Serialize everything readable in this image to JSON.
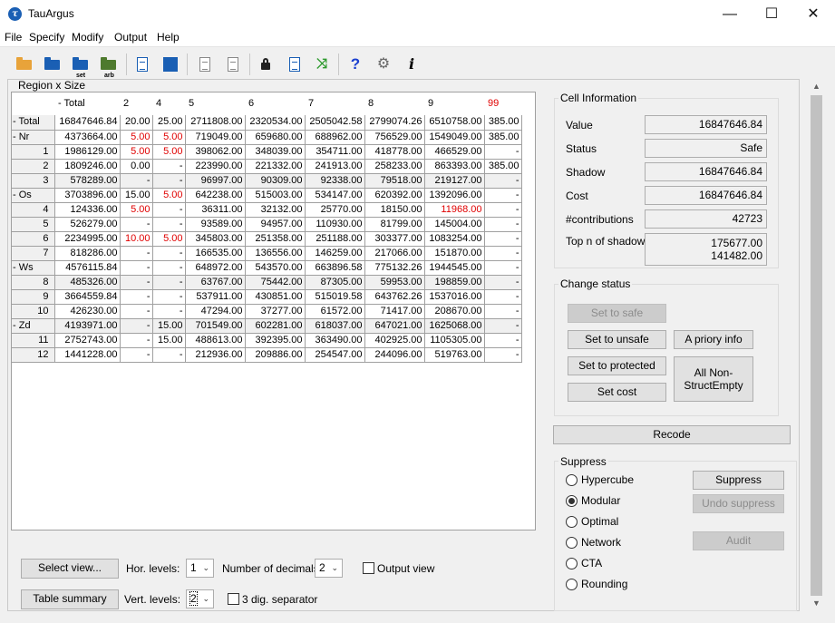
{
  "window": {
    "title": "TauArgus",
    "minimize": "—",
    "maximize": "☐",
    "close": "✕"
  },
  "menu": [
    "File",
    "Specify",
    "Modify",
    "Output",
    "Help"
  ],
  "toolbar": {
    "icons": [
      "open-table-icon",
      "open-batch-icon",
      "open-set-icon",
      "open-arb-icon",
      "view-report-icon",
      "table-list-icon",
      "output-icon",
      "output-save-icon",
      "lock-icon",
      "search-doc-icon",
      "shuffle-icon",
      "help-icon",
      "settings-icon",
      "info-icon"
    ],
    "sub_set": "set",
    "sub_arb": "arb",
    "help_glyph": "?",
    "info_glyph": "i",
    "shuffle_glyph": "⤨",
    "settings_glyph": "⚙"
  },
  "table": {
    "title": "Region x Size",
    "columns": [
      "- Total",
      "2",
      "4",
      "5",
      "6",
      "7",
      "8",
      "9",
      "99"
    ],
    "rows": [
      {
        "label": "- Total",
        "sub": false,
        "cells": [
          "16847646.84",
          "20.00",
          "25.00",
          "2711808.00",
          "2320534.00",
          "2505042.58",
          "2799074.26",
          "6510758.00",
          "385.00"
        ],
        "red": []
      },
      {
        "label": "- Nr",
        "sub": false,
        "cells": [
          "4373664.00",
          "5.00",
          "5.00",
          "719049.00",
          "659680.00",
          "688962.00",
          "756529.00",
          "1549049.00",
          "385.00"
        ],
        "red": [
          1,
          2
        ]
      },
      {
        "label": "1",
        "sub": true,
        "cells": [
          "1986129.00",
          "5.00",
          "5.00",
          "398062.00",
          "348039.00",
          "354711.00",
          "418778.00",
          "466529.00",
          "-"
        ],
        "red": [
          1,
          2
        ]
      },
      {
        "label": "2",
        "sub": true,
        "cells": [
          "1809246.00",
          "0.00",
          "-",
          "223990.00",
          "221332.00",
          "241913.00",
          "258233.00",
          "863393.00",
          "385.00"
        ],
        "red": []
      },
      {
        "label": "3",
        "sub": true,
        "cells": [
          "578289.00",
          "-",
          "-",
          "96997.00",
          "90309.00",
          "92338.00",
          "79518.00",
          "219127.00",
          "-"
        ],
        "red": []
      },
      {
        "label": "- Os",
        "sub": false,
        "cells": [
          "3703896.00",
          "15.00",
          "5.00",
          "642238.00",
          "515003.00",
          "534147.00",
          "620392.00",
          "1392096.00",
          "-"
        ],
        "red": [
          2
        ]
      },
      {
        "label": "4",
        "sub": true,
        "cells": [
          "124336.00",
          "5.00",
          "-",
          "36311.00",
          "32132.00",
          "25770.00",
          "18150.00",
          "11968.00",
          "-"
        ],
        "red": [
          1,
          7
        ]
      },
      {
        "label": "5",
        "sub": true,
        "cells": [
          "526279.00",
          "-",
          "-",
          "93589.00",
          "94957.00",
          "110930.00",
          "81799.00",
          "145004.00",
          "-"
        ],
        "red": []
      },
      {
        "label": "6",
        "sub": true,
        "cells": [
          "2234995.00",
          "10.00",
          "5.00",
          "345803.00",
          "251358.00",
          "251188.00",
          "303377.00",
          "1083254.00",
          "-"
        ],
        "red": [
          1,
          2
        ]
      },
      {
        "label": "7",
        "sub": true,
        "cells": [
          "818286.00",
          "-",
          "-",
          "166535.00",
          "136556.00",
          "146259.00",
          "217066.00",
          "151870.00",
          "-"
        ],
        "red": []
      },
      {
        "label": "- Ws",
        "sub": false,
        "cells": [
          "4576115.84",
          "-",
          "-",
          "648972.00",
          "543570.00",
          "663896.58",
          "775132.26",
          "1944545.00",
          "-"
        ],
        "red": []
      },
      {
        "label": "8",
        "sub": true,
        "cells": [
          "485326.00",
          "-",
          "-",
          "63767.00",
          "75442.00",
          "87305.00",
          "59953.00",
          "198859.00",
          "-"
        ],
        "red": []
      },
      {
        "label": "9",
        "sub": true,
        "cells": [
          "3664559.84",
          "-",
          "-",
          "537911.00",
          "430851.00",
          "515019.58",
          "643762.26",
          "1537016.00",
          "-"
        ],
        "red": []
      },
      {
        "label": "10",
        "sub": true,
        "cells": [
          "426230.00",
          "-",
          "-",
          "47294.00",
          "37277.00",
          "61572.00",
          "71417.00",
          "208670.00",
          "-"
        ],
        "red": []
      },
      {
        "label": "- Zd",
        "sub": false,
        "cells": [
          "4193971.00",
          "-",
          "15.00",
          "701549.00",
          "602281.00",
          "618037.00",
          "647021.00",
          "1625068.00",
          "-"
        ],
        "red": []
      },
      {
        "label": "11",
        "sub": true,
        "cells": [
          "2752743.00",
          "-",
          "15.00",
          "488613.00",
          "392395.00",
          "363490.00",
          "402925.00",
          "1105305.00",
          "-"
        ],
        "red": []
      },
      {
        "label": "12",
        "sub": true,
        "cells": [
          "1441228.00",
          "-",
          "-",
          "212936.00",
          "209886.00",
          "254547.00",
          "244096.00",
          "519763.00",
          "-"
        ],
        "red": []
      }
    ]
  },
  "cell_info": {
    "title": "Cell Information",
    "value_label": "Value",
    "value": "16847646.84",
    "status_label": "Status",
    "status": "Safe",
    "shadow_label": "Shadow",
    "shadow": "16847646.84",
    "cost_label": "Cost",
    "cost": "16847646.84",
    "contrib_label": "#contributions",
    "contrib": "42723",
    "topn_label": "Top n of shadow",
    "topn_1": "175677.00",
    "topn_2": "141482.00"
  },
  "change_status": {
    "title": "Change status",
    "set_to_safe": "Set to safe",
    "set_to_unsafe": "Set to unsafe",
    "a_priory_info": "A priory info",
    "set_to_protected": "Set to protected",
    "set_cost": "Set cost",
    "all_non_struct_empty_1": "All Non-",
    "all_non_struct_empty_2": "StructEmpty"
  },
  "recode": "Recode",
  "suppress": {
    "title": "Suppress",
    "options": [
      "Hypercube",
      "Modular",
      "Optimal",
      "Network",
      "CTA",
      "Rounding"
    ],
    "selected": "Modular",
    "suppress_btn": "Suppress",
    "undo_btn": "Undo suppress",
    "audit_btn": "Audit"
  },
  "bottom": {
    "select_view": "Select view...",
    "table_summary": "Table summary",
    "hor_levels_label": "Hor. levels:",
    "hor_levels_value": "1",
    "vert_levels_label": "Vert. levels:",
    "vert_levels_value": "2",
    "decimals_label": "Number of decimals:",
    "decimals_value": "2",
    "output_view_label": "Output view",
    "dig_sep_label": "3 dig. separator",
    "output_view_checked": false,
    "dig_sep_checked": false
  },
  "colors": {
    "red": "#e00000",
    "accent": "#1a5fb4"
  }
}
